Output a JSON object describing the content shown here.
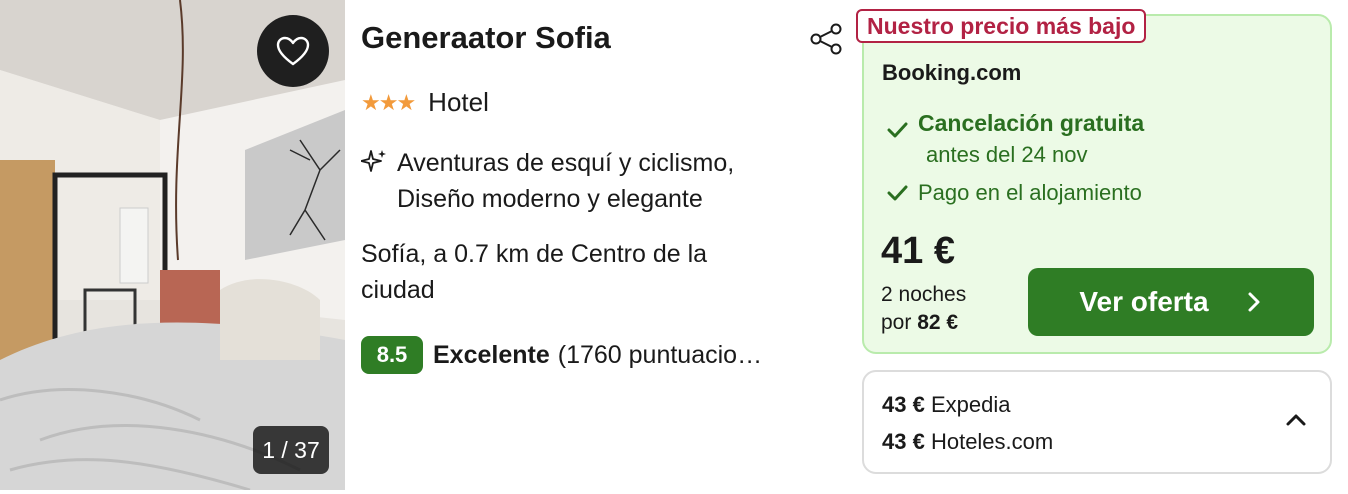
{
  "photo": {
    "counter": "1 / 37",
    "favorite_icon": "heart-icon"
  },
  "hotel": {
    "name": "Generaator Sofia",
    "stars": "★★★",
    "star_count": 3,
    "type": "Hotel",
    "feature_icon": "sparkles-icon",
    "features_line1": "Aventuras de esquí y ciclismo,",
    "features_line2": "Diseño moderno y elegante",
    "location": "Sofía, a 0.7 km de Centro de la ciudad",
    "score": "8.5",
    "score_label": "Excelente",
    "review_count": "(1760 puntuaciones)"
  },
  "offer": {
    "badge": "Nuestro precio más bajo",
    "provider": "Booking.com",
    "cancel_title": "Cancelación gratuita",
    "cancel_sub": "antes del 24 nov",
    "payment": "Pago en el alojamiento",
    "price": "41 €",
    "nights_text": "2 noches",
    "total_prefix": "por",
    "total": "82 €",
    "cta_label": "Ver oferta",
    "colors": {
      "accent": "#2f7d25",
      "card_bg": "#ecfae6",
      "badge": "#b22244",
      "stars": "#f29a3b"
    }
  },
  "other_offers": [
    {
      "price": "43 €",
      "provider": "Expedia"
    },
    {
      "price": "43 €",
      "provider": "Hoteles.com"
    }
  ]
}
